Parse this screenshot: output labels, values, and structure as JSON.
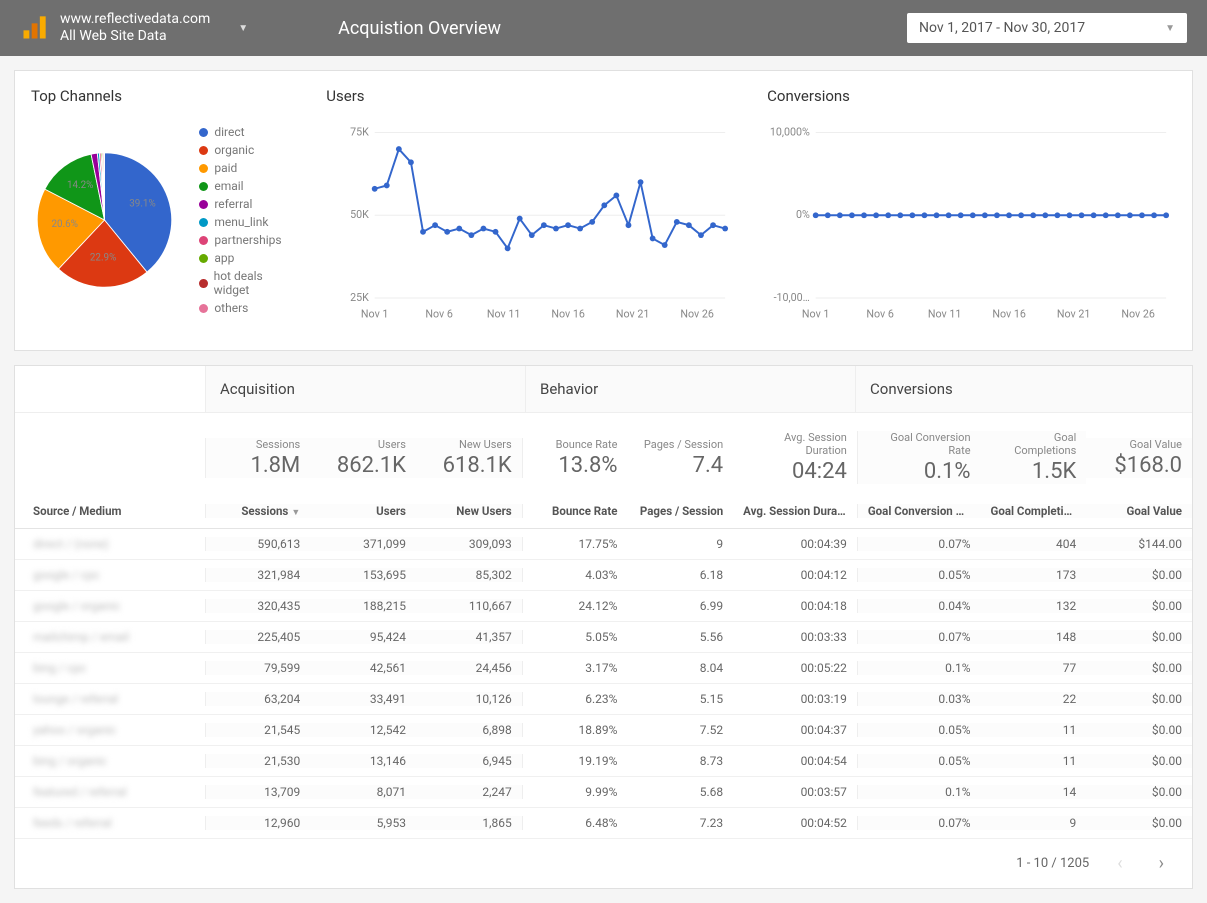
{
  "header": {
    "site_url": "www.reflectivedata.com",
    "view_name": "All Web Site Data",
    "page_title": "Acquistion Overview",
    "date_range": "Nov 1, 2017 - Nov 30, 2017"
  },
  "panels": {
    "top_channels_title": "Top Channels",
    "users_title": "Users",
    "conversions_title": "Conversions"
  },
  "chart_data": {
    "pie": {
      "type": "pie",
      "title": "Top Channels",
      "slices": [
        {
          "name": "direct",
          "value": 39.1,
          "label": "39.1%",
          "color": "#3366cc"
        },
        {
          "name": "organic",
          "value": 22.9,
          "label": "22.9%",
          "color": "#dc3912"
        },
        {
          "name": "paid",
          "value": 20.6,
          "label": "20.6%",
          "color": "#ff9900"
        },
        {
          "name": "email",
          "value": 14.2,
          "label": "14.2%",
          "color": "#109618"
        },
        {
          "name": "referral",
          "value": 1.5,
          "label": "",
          "color": "#990099"
        },
        {
          "name": "menu_link",
          "value": 0.5,
          "label": "",
          "color": "#0099c6"
        },
        {
          "name": "partnerships",
          "value": 0.4,
          "label": "",
          "color": "#dd4477"
        },
        {
          "name": "app",
          "value": 0.3,
          "label": "",
          "color": "#66aa00"
        },
        {
          "name": "hot deals widget",
          "value": 0.3,
          "label": "",
          "color": "#b82e2e"
        },
        {
          "name": "others",
          "value": 0.2,
          "label": "",
          "color": "#e67399"
        }
      ]
    },
    "users_line": {
      "type": "line",
      "title": "Users",
      "ylabel": "",
      "xlabel": "",
      "ylim": [
        25000,
        75000
      ],
      "yticks": [
        "25K",
        "50K",
        "75K"
      ],
      "xticks": [
        "Nov 1",
        "Nov 6",
        "Nov 11",
        "Nov 16",
        "Nov 21",
        "Nov 26"
      ],
      "x": [
        1,
        2,
        3,
        4,
        5,
        6,
        7,
        8,
        9,
        10,
        11,
        12,
        13,
        14,
        15,
        16,
        17,
        18,
        19,
        20,
        21,
        22,
        23,
        24,
        25,
        26,
        27,
        28,
        29,
        30
      ],
      "values": [
        58000,
        59000,
        70000,
        66000,
        45000,
        47000,
        45000,
        46000,
        44000,
        46000,
        45000,
        40000,
        49000,
        44000,
        47000,
        46000,
        47000,
        46000,
        48000,
        53000,
        56000,
        47000,
        60000,
        43000,
        41000,
        48000,
        47000,
        44000,
        47000,
        46000
      ]
    },
    "conversions_line": {
      "type": "line",
      "title": "Conversions",
      "ylabel": "",
      "xlabel": "",
      "ylim": [
        -10000,
        10000
      ],
      "yticks": [
        "-10,00…",
        "0%",
        "10,000%"
      ],
      "xticks": [
        "Nov 1",
        "Nov 6",
        "Nov 11",
        "Nov 16",
        "Nov 21",
        "Nov 26"
      ],
      "x": [
        1,
        2,
        3,
        4,
        5,
        6,
        7,
        8,
        9,
        10,
        11,
        12,
        13,
        14,
        15,
        16,
        17,
        18,
        19,
        20,
        21,
        22,
        23,
        24,
        25,
        26,
        27,
        28,
        29,
        30
      ],
      "values": [
        0,
        0,
        0,
        0,
        0,
        0,
        0,
        0,
        0,
        0,
        0,
        0,
        0,
        0,
        0,
        0,
        0,
        0,
        0,
        0,
        0,
        0,
        0,
        0,
        0,
        0,
        0,
        0,
        0,
        0
      ]
    }
  },
  "table": {
    "groups": {
      "acq": "Acquisition",
      "beh": "Behavior",
      "conv": "Conversions"
    },
    "totals_labels": {
      "sessions": "Sessions",
      "users": "Users",
      "new_users": "New Users",
      "bounce": "Bounce Rate",
      "pps": "Pages / Session",
      "asd": "Avg. Session Duration",
      "gcr": "Goal Conversion Rate",
      "gc": "Goal Completions",
      "gv": "Goal Value"
    },
    "totals": {
      "sessions": "1.8M",
      "users": "862.1K",
      "new_users": "618.1K",
      "bounce": "13.8%",
      "pps": "7.4",
      "asd": "04:24",
      "gcr": "0.1%",
      "gc": "1.5K",
      "gv": "$168.0"
    },
    "headers": {
      "src": "Source / Medium",
      "sessions": "Sessions",
      "users": "Users",
      "new_users": "New Users",
      "bounce": "Bounce Rate",
      "pps": "Pages / Session",
      "asd": "Avg. Session Duration",
      "gcr": "Goal Conversion Rate",
      "gc": "Goal Completio…",
      "gv": "Goal Value"
    },
    "rows": [
      {
        "src": "direct / (none)",
        "sessions": "590,613",
        "users": "371,099",
        "new_users": "309,093",
        "bounce": "17.75%",
        "pps": "9",
        "asd": "00:04:39",
        "gcr": "0.07%",
        "gc": "404",
        "gv": "$144.00"
      },
      {
        "src": "google / cpc",
        "sessions": "321,984",
        "users": "153,695",
        "new_users": "85,302",
        "bounce": "4.03%",
        "pps": "6.18",
        "asd": "00:04:12",
        "gcr": "0.05%",
        "gc": "173",
        "gv": "$0.00"
      },
      {
        "src": "google / organic",
        "sessions": "320,435",
        "users": "188,215",
        "new_users": "110,667",
        "bounce": "24.12%",
        "pps": "6.99",
        "asd": "00:04:18",
        "gcr": "0.04%",
        "gc": "132",
        "gv": "$0.00"
      },
      {
        "src": "mailchimp / email",
        "sessions": "225,405",
        "users": "95,424",
        "new_users": "41,357",
        "bounce": "5.05%",
        "pps": "5.56",
        "asd": "00:03:33",
        "gcr": "0.07%",
        "gc": "148",
        "gv": "$0.00"
      },
      {
        "src": "bing / cpc",
        "sessions": "79,599",
        "users": "42,561",
        "new_users": "24,456",
        "bounce": "3.17%",
        "pps": "8.04",
        "asd": "00:05:22",
        "gcr": "0.1%",
        "gc": "77",
        "gv": "$0.00"
      },
      {
        "src": "lounge / referral",
        "sessions": "63,204",
        "users": "33,491",
        "new_users": "10,126",
        "bounce": "6.23%",
        "pps": "5.15",
        "asd": "00:03:19",
        "gcr": "0.03%",
        "gc": "22",
        "gv": "$0.00"
      },
      {
        "src": "yahoo / organic",
        "sessions": "21,545",
        "users": "12,542",
        "new_users": "6,898",
        "bounce": "18.89%",
        "pps": "7.52",
        "asd": "00:04:37",
        "gcr": "0.05%",
        "gc": "11",
        "gv": "$0.00"
      },
      {
        "src": "bing / organic",
        "sessions": "21,530",
        "users": "13,146",
        "new_users": "6,945",
        "bounce": "19.19%",
        "pps": "8.73",
        "asd": "00:04:54",
        "gcr": "0.05%",
        "gc": "11",
        "gv": "$0.00"
      },
      {
        "src": "featured / referral",
        "sessions": "13,709",
        "users": "8,071",
        "new_users": "2,247",
        "bounce": "9.99%",
        "pps": "5.68",
        "asd": "00:03:57",
        "gcr": "0.1%",
        "gc": "14",
        "gv": "$0.00"
      },
      {
        "src": "feeds / referral",
        "sessions": "12,960",
        "users": "5,953",
        "new_users": "1,865",
        "bounce": "6.48%",
        "pps": "7.23",
        "asd": "00:04:52",
        "gcr": "0.07%",
        "gc": "9",
        "gv": "$0.00"
      }
    ],
    "pager": "1 - 10 / 1205"
  }
}
